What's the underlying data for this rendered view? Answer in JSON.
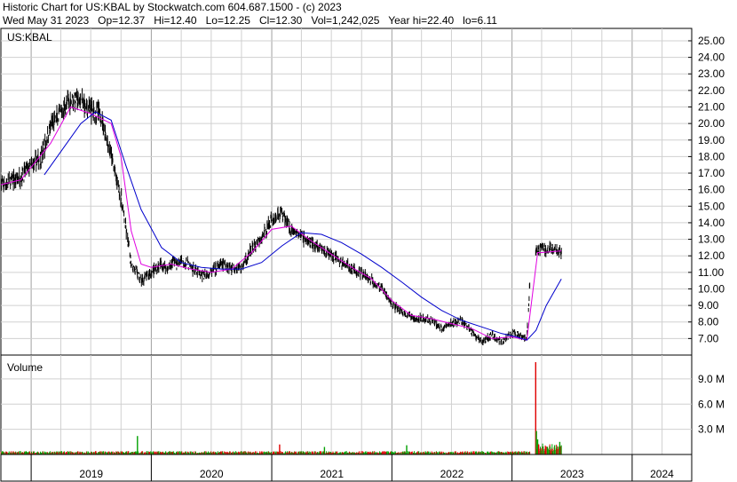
{
  "header": {
    "title": "Historic Chart for US:KBAL by Stockwatch.com 604.687.1500 - (c) 2023",
    "stats": "Wed May 31 2023   Op=12.37   Hi=12.40   Lo=12.25   Cl=12.30   Vol=1,242,025   Year hi=22.40   lo=6.11"
  },
  "price_panel": {
    "symbol_label": "US:KBAL"
  },
  "volume_panel": {
    "label": "Volume"
  },
  "colors": {
    "price": "#000000",
    "ma_short": "#e000e0",
    "ma_long": "#0000cc",
    "vol_up": "#00a000",
    "vol_down": "#e00000",
    "grid": "#d0d0d0",
    "border": "#000000"
  },
  "chart_data": {
    "type": "line",
    "title": "Historic Chart for US:KBAL by Stockwatch.com 604.687.1500 - (c) 2023",
    "x_ticks": [
      "2019",
      "2020",
      "2021",
      "2022",
      "2023",
      "2024"
    ],
    "xlim": [
      "2018-10-01",
      "2024-06-30"
    ],
    "ylim": [
      6.0,
      25.75
    ],
    "y_ticks": [
      7,
      8,
      9,
      10,
      11,
      12,
      13,
      14,
      15,
      16,
      17,
      18,
      19,
      20,
      21,
      22,
      23,
      24,
      25
    ],
    "y_tick_labels": [
      "7.00",
      "8.00",
      "9.00",
      "10.00",
      "11.00",
      "12.00",
      "13.00",
      "14.00",
      "15.00",
      "16.00",
      "17.00",
      "18.00",
      "19.00",
      "20.00",
      "21.00",
      "22.00",
      "23.00",
      "24.00",
      "25.00"
    ],
    "series": [
      {
        "name": "",
        "kind": "close",
        "dates": [
          "2018-10-01",
          "2018-11-01",
          "2018-12-01",
          "2019-01-01",
          "2019-02-01",
          "2019-03-01",
          "2019-04-01",
          "2019-05-01",
          "2019-06-01",
          "2019-07-01",
          "2019-08-01",
          "2019-09-01",
          "2019-10-01",
          "2019-11-01",
          "2019-12-01",
          "2020-01-01",
          "2020-02-01",
          "2020-02-20",
          "2020-03-10",
          "2020-03-20",
          "2020-04-01",
          "2020-05-01",
          "2020-06-01",
          "2020-07-01",
          "2020-08-01",
          "2020-09-01",
          "2020-10-01",
          "2020-11-01",
          "2020-12-01",
          "2021-01-01",
          "2021-02-01",
          "2021-03-01",
          "2021-04-01",
          "2021-05-01",
          "2021-06-01",
          "2021-07-01",
          "2021-08-01",
          "2021-09-01",
          "2021-10-01",
          "2021-11-01",
          "2021-12-01",
          "2022-01-01",
          "2022-02-01",
          "2022-03-01",
          "2022-04-01",
          "2022-05-01",
          "2022-06-01",
          "2022-07-01",
          "2022-08-01",
          "2022-09-01",
          "2022-10-01",
          "2022-11-01",
          "2022-12-01",
          "2023-01-01",
          "2023-02-01",
          "2023-02-15",
          "2023-03-01",
          "2023-04-01",
          "2023-05-01",
          "2023-05-31"
        ],
        "values": [
          16.2,
          16.5,
          16.8,
          17.4,
          18.0,
          19.8,
          20.6,
          21.5,
          21.3,
          20.8,
          20.5,
          18.0,
          15.5,
          11.5,
          10.5,
          11.0,
          11.5,
          11.2,
          11.8,
          11.4,
          11.8,
          11.3,
          10.8,
          11.0,
          11.5,
          11.3,
          11.3,
          12.4,
          13.0,
          14.2,
          14.6,
          13.6,
          13.2,
          12.7,
          12.4,
          12.0,
          11.6,
          11.2,
          10.9,
          10.5,
          10.0,
          9.1,
          8.6,
          8.3,
          8.2,
          8.1,
          7.6,
          7.9,
          8.1,
          7.4,
          6.8,
          7.2,
          6.8,
          7.3,
          7.2,
          6.9,
          12.3,
          12.4,
          12.4,
          12.3
        ]
      },
      {
        "name": "",
        "kind": "moving-average-short",
        "dates": [
          "2018-10-01",
          "2018-12-01",
          "2019-03-01",
          "2019-05-01",
          "2019-07-01",
          "2019-09-01",
          "2019-10-01",
          "2019-11-01",
          "2019-12-01",
          "2020-01-01",
          "2020-03-01",
          "2020-05-01",
          "2020-07-01",
          "2020-09-01",
          "2020-11-01",
          "2021-01-01",
          "2021-03-01",
          "2021-05-01",
          "2021-07-01",
          "2021-09-01",
          "2021-11-01",
          "2022-01-01",
          "2022-03-01",
          "2022-05-01",
          "2022-07-01",
          "2022-09-01",
          "2022-11-01",
          "2023-01-01",
          "2023-02-15",
          "2023-03-20",
          "2023-04-01",
          "2023-05-31"
        ],
        "values": [
          16.3,
          16.6,
          18.8,
          21.0,
          20.6,
          20.0,
          18.0,
          13.5,
          11.5,
          11.3,
          11.5,
          11.2,
          11.0,
          11.2,
          12.2,
          13.6,
          13.8,
          12.9,
          12.1,
          11.3,
          10.6,
          9.3,
          8.4,
          8.2,
          7.9,
          7.6,
          7.0,
          7.1,
          6.9,
          12.2,
          12.2,
          12.3
        ]
      },
      {
        "name": "",
        "kind": "moving-average-long",
        "dates": [
          "2019-02-10",
          "2019-04-01",
          "2019-06-01",
          "2019-07-15",
          "2019-09-01",
          "2019-10-15",
          "2019-12-01",
          "2020-02-01",
          "2020-04-01",
          "2020-06-01",
          "2020-08-01",
          "2020-10-01",
          "2020-12-01",
          "2021-02-01",
          "2021-04-01",
          "2021-06-01",
          "2021-08-01",
          "2021-10-01",
          "2021-12-01",
          "2022-02-01",
          "2022-04-01",
          "2022-06-01",
          "2022-08-01",
          "2022-10-01",
          "2022-12-01",
          "2023-01-15",
          "2023-02-15",
          "2023-03-15",
          "2023-04-15",
          "2023-05-31"
        ],
        "values": [
          16.9,
          18.3,
          20.0,
          20.7,
          20.2,
          17.5,
          14.8,
          12.5,
          11.6,
          11.3,
          11.2,
          11.2,
          11.6,
          12.6,
          13.4,
          13.3,
          12.8,
          12.1,
          11.3,
          10.4,
          9.5,
          8.7,
          8.1,
          7.7,
          7.3,
          7.1,
          6.9,
          7.5,
          9.0,
          10.6
        ]
      }
    ],
    "volume": {
      "ylim": [
        0,
        11000000
      ],
      "y_ticks": [
        3000000,
        6000000,
        9000000
      ],
      "y_tick_labels": [
        "3.0 M",
        "6.0 M",
        "9.0 M"
      ],
      "spike_dates": [
        "2019-11-20",
        "2021-01-25",
        "2021-06-10",
        "2022-02-15",
        "2023-03-14",
        "2023-03-16",
        "2023-03-20",
        "2023-03-23",
        "2023-05-26"
      ],
      "spike_values": [
        2200000,
        1200000,
        900000,
        1100000,
        11000000,
        2800000,
        1800000,
        1200000,
        1500000
      ]
    }
  }
}
